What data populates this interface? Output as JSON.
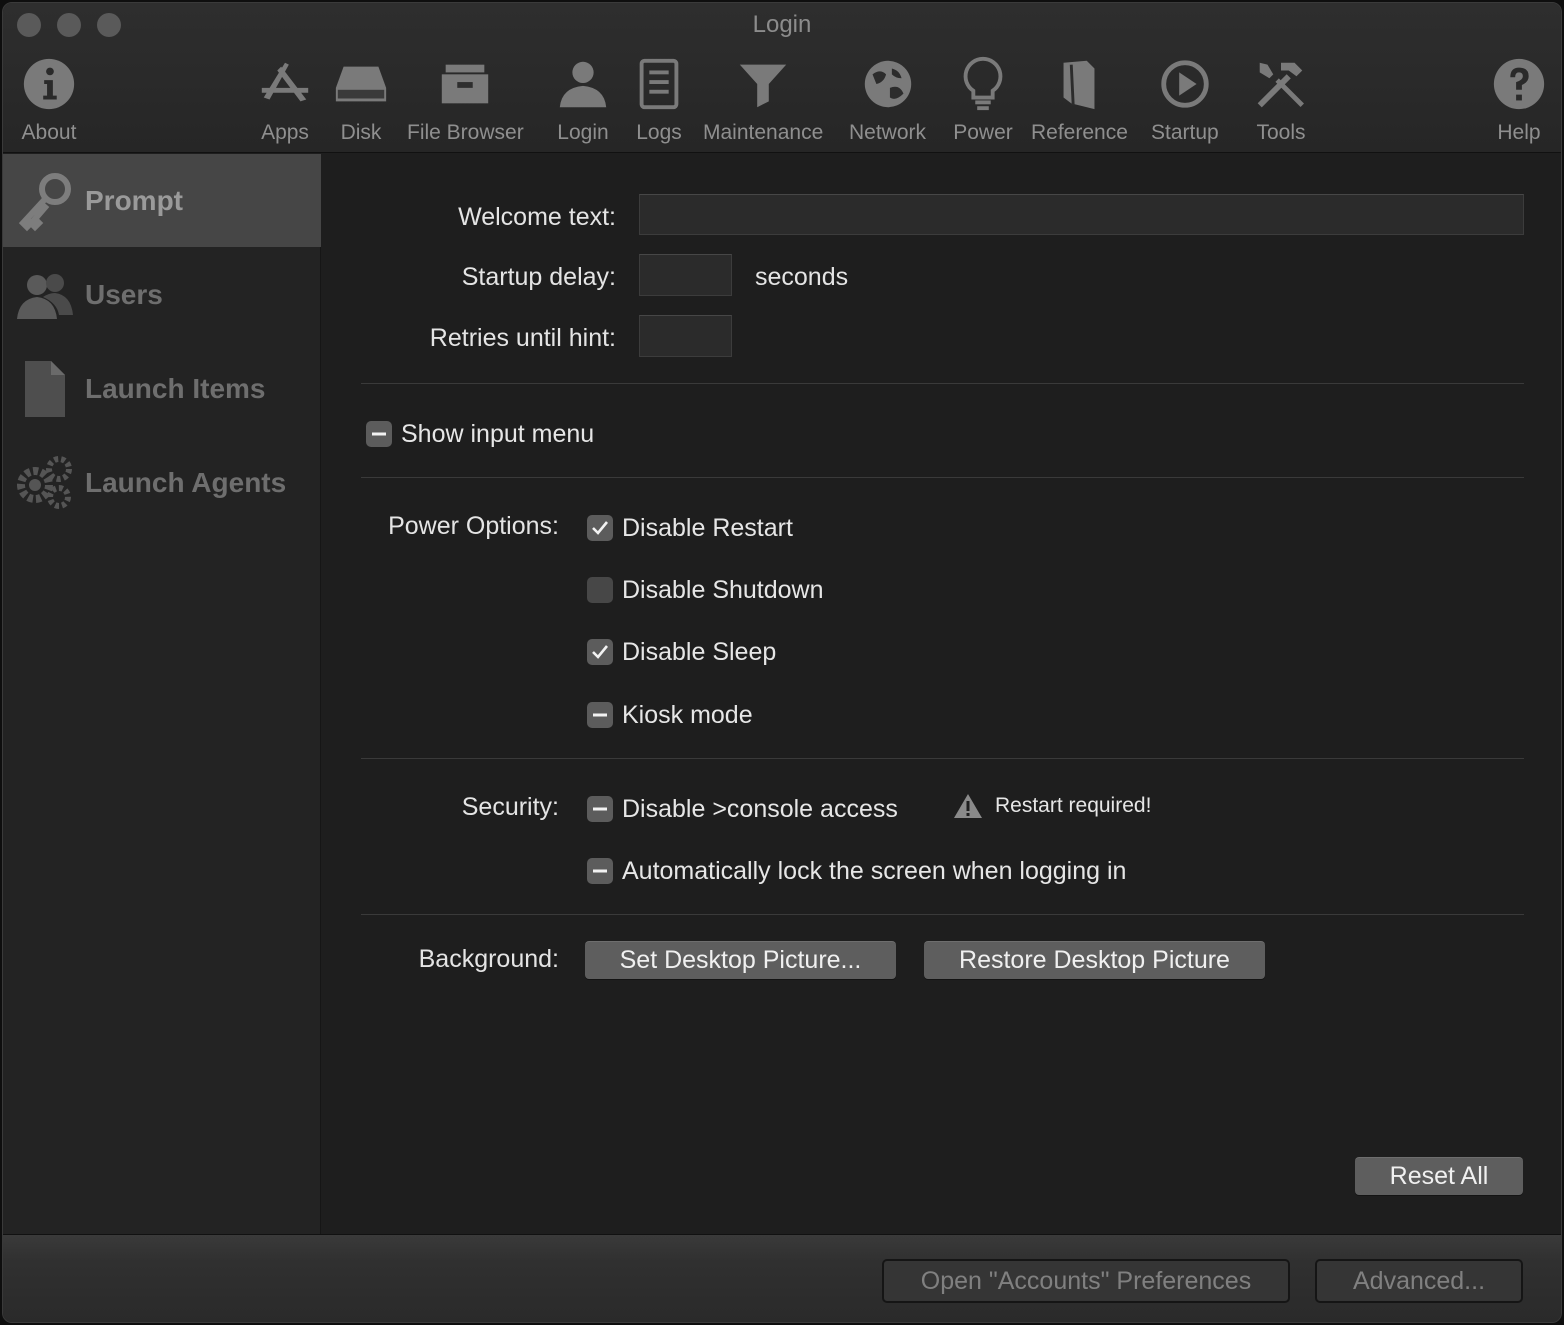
{
  "window": {
    "title": "Login"
  },
  "toolbar": {
    "items": [
      {
        "label": "About",
        "icon": "info-icon"
      },
      {
        "label": "Apps",
        "icon": "apps-icon"
      },
      {
        "label": "Disk",
        "icon": "disk-icon"
      },
      {
        "label": "File Browser",
        "icon": "file-browser-icon"
      },
      {
        "label": "Login",
        "icon": "login-icon"
      },
      {
        "label": "Logs",
        "icon": "logs-icon"
      },
      {
        "label": "Maintenance",
        "icon": "funnel-icon"
      },
      {
        "label": "Network",
        "icon": "globe-icon"
      },
      {
        "label": "Power",
        "icon": "lightbulb-icon"
      },
      {
        "label": "Reference",
        "icon": "book-icon"
      },
      {
        "label": "Startup",
        "icon": "play-icon"
      },
      {
        "label": "Tools",
        "icon": "tools-icon"
      },
      {
        "label": "Help",
        "icon": "help-icon"
      }
    ]
  },
  "sidebar": {
    "items": [
      {
        "label": "Prompt",
        "icon": "key-icon",
        "selected": true
      },
      {
        "label": "Users",
        "icon": "users-icon",
        "selected": false
      },
      {
        "label": "Launch Items",
        "icon": "document-icon",
        "selected": false
      },
      {
        "label": "Launch Agents",
        "icon": "gears-icon",
        "selected": false
      }
    ]
  },
  "prompt": {
    "welcome_label": "Welcome text:",
    "welcome_value": "",
    "startup_delay_label": "Startup delay:",
    "startup_delay_value": "",
    "seconds_label": "seconds",
    "retries_label": "Retries until hint:",
    "retries_value": "",
    "show_input_menu": {
      "label": "Show input menu",
      "state": "mixed"
    },
    "power_label": "Power Options:",
    "power_options": [
      {
        "label": "Disable Restart",
        "state": "checked"
      },
      {
        "label": "Disable Shutdown",
        "state": "unchecked"
      },
      {
        "label": "Disable Sleep",
        "state": "checked"
      },
      {
        "label": "Kiosk mode",
        "state": "mixed"
      }
    ],
    "security_label": "Security:",
    "security_options": [
      {
        "label": "Disable >console access",
        "state": "mixed"
      },
      {
        "label": "Automatically lock the screen when logging in",
        "state": "mixed"
      }
    ],
    "restart_warning": "Restart required!",
    "background_label": "Background:",
    "set_desktop_button": "Set Desktop Picture...",
    "restore_desktop_button": "Restore Desktop Picture",
    "reset_all_button": "Reset All"
  },
  "bottom": {
    "open_accounts_button": "Open \"Accounts\" Preferences",
    "advanced_button": "Advanced..."
  },
  "colors": {
    "window_bg": "#1e1e1e",
    "sidebar_selected": "#464646",
    "button_bg": "#5e5e5e",
    "text": "#e6e6e6",
    "muted_text": "#8f8f8f"
  }
}
